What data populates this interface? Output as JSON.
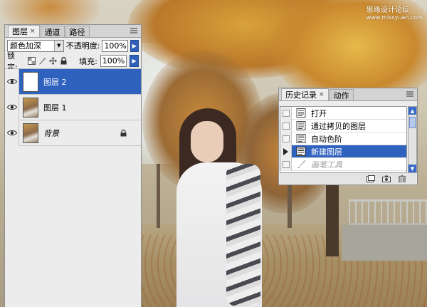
{
  "watermark": {
    "name": "思缘设计论坛",
    "url": "www.missyuan.com"
  },
  "layers_panel": {
    "tabs": [
      {
        "label": "图层",
        "close": "×"
      },
      {
        "label": "通道"
      },
      {
        "label": "路径"
      }
    ],
    "blend_mode": "颜色加深",
    "opacity_label": "不透明度:",
    "opacity_value": "100%",
    "lock_label": "锁定:",
    "fill_label": "填充:",
    "fill_value": "100%",
    "layers": [
      {
        "name": "图层 2",
        "thumbnail": "white",
        "selected": true
      },
      {
        "name": "图层 1",
        "thumbnail": "photo",
        "selected": false
      },
      {
        "name": "背景",
        "thumbnail": "photo",
        "locked": true,
        "selected": false
      }
    ]
  },
  "history_panel": {
    "tabs": [
      {
        "label": "历史记录",
        "close": "×"
      },
      {
        "label": "动作"
      }
    ],
    "items": [
      {
        "label": "打开",
        "state": "normal"
      },
      {
        "label": "通过拷贝的图层",
        "state": "normal"
      },
      {
        "label": "自动色阶",
        "state": "normal"
      },
      {
        "label": "新建图层",
        "state": "selected"
      },
      {
        "label": "画笔工具",
        "state": "dimmed"
      }
    ]
  },
  "colors": {
    "selection": "#2f61bf",
    "panel_bg": "#ececec"
  },
  "icons": [
    "eye-icon",
    "lock-icon",
    "brush-icon",
    "move-icon",
    "history-state-icon",
    "camera-icon",
    "trash-icon",
    "panel-menu-icon"
  ]
}
